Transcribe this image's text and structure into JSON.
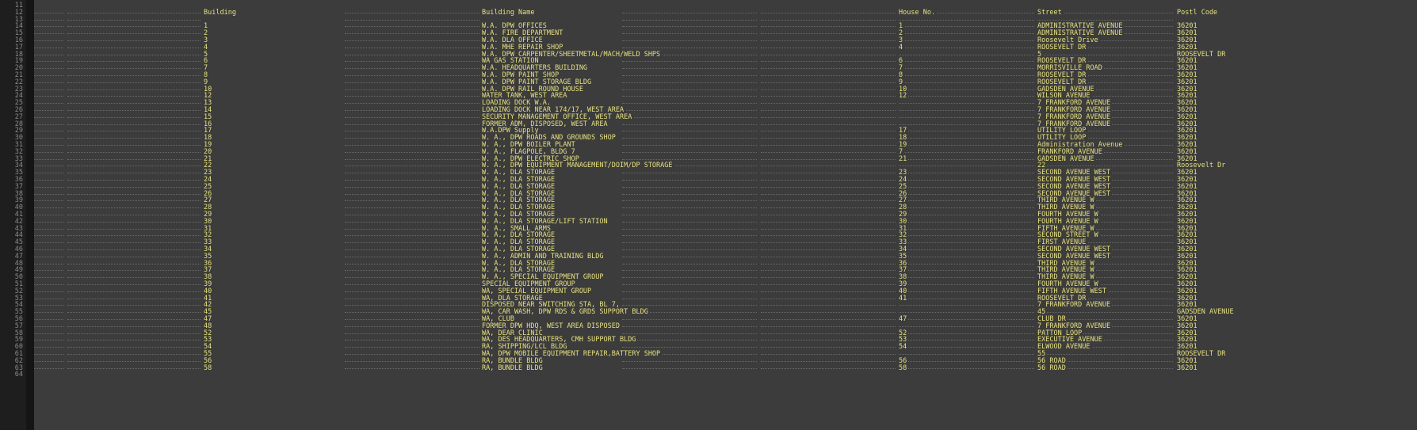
{
  "editor": {
    "first_line_number": 11,
    "last_line_number": 64
  },
  "header": {
    "building": "Building",
    "building_name": "Building Name",
    "house_no": "House No.",
    "street": "Street",
    "postl_code": "Postl Code"
  },
  "rows": [
    {
      "building": "1",
      "name": "W.A. DPW OFFICES",
      "house": "1",
      "street": "ADMINISTRATIVE AVENUE",
      "postal": "36201"
    },
    {
      "building": "2",
      "name": "W.A. FIRE DEPARTMENT",
      "house": "2",
      "street": "ADMINISTRATIVE AVENUE",
      "postal": "36201"
    },
    {
      "building": "3",
      "name": "W.A. DLA OFFICE",
      "house": "3",
      "street": "Roosevelt Drive",
      "postal": "36201"
    },
    {
      "building": "4",
      "name": "W.A. MHE REPAIR SHOP",
      "house": "4",
      "street": "ROOSEVELT DR",
      "postal": "36201"
    },
    {
      "building": "5",
      "name": "W.A. DPW CARPENTER/SHEETMETAL/MACH/WELD SHPS",
      "house": "",
      "street": "5",
      "postal": "ROOSEVELT DR"
    },
    {
      "building": "6",
      "name": "WA GAS STATION",
      "house": "6",
      "street": "ROOSEVELT DR",
      "postal": "36201"
    },
    {
      "building": "7",
      "name": "W.A. HEADQUARTERS BUILDING",
      "house": "7",
      "street": "MORRISVILLE ROAD",
      "postal": "36201"
    },
    {
      "building": "8",
      "name": "W.A. DPW PAINT SHOP",
      "house": "8",
      "street": "ROOSEVELT DR",
      "postal": "36201"
    },
    {
      "building": "9",
      "name": "W.A. DPW PAINT STORAGE BLDG",
      "house": "9",
      "street": "ROOSEVELT DR",
      "postal": "36201"
    },
    {
      "building": "10",
      "name": "W.A. DPW RAIL ROUND HOUSE",
      "house": "10",
      "street": "GADSDEN AVENUE",
      "postal": "36201"
    },
    {
      "building": "12",
      "name": "WATER TANK, WEST AREA",
      "house": "12",
      "street": "WILSON AVENUE",
      "postal": "36201"
    },
    {
      "building": "13",
      "name": "LOADING DOCK W.A.",
      "house": "",
      "street": "7 FRANKFORD AVENUE",
      "postal": "36201"
    },
    {
      "building": "14",
      "name": "LOADING DOCK NEAR 174/17, WEST AREA",
      "house": "",
      "street": "7 FRANKFORD AVENUE",
      "postal": "36201"
    },
    {
      "building": "15",
      "name": "SECURITY MANAGEMENT OFFICE, WEST AREA",
      "house": "",
      "street": "7 FRANKFORD AVENUE",
      "postal": "36201"
    },
    {
      "building": "16",
      "name": "FORMER ADM, DISPOSED, WEST AREA",
      "house": "",
      "street": "7 FRANKFORD AVENUE",
      "postal": "36201"
    },
    {
      "building": "17",
      "name": "W.A.DPW Supply",
      "house": "17",
      "street": "UTILITY LOOP",
      "postal": "36201"
    },
    {
      "building": "18",
      "name": "W. A., DPW ROADS AND GROUNDS SHOP",
      "house": "18",
      "street": "UTILITY LOOP",
      "postal": "36201"
    },
    {
      "building": "19",
      "name": "W. A., DPW BOILER PLANT",
      "house": "19",
      "street": "Administration Avenue",
      "postal": "36201"
    },
    {
      "building": "20",
      "name": "W. A., FLAGPOLE, BLDG 7",
      "house": "7",
      "street": "FRANKFORD AVENUE",
      "postal": "36201"
    },
    {
      "building": "21",
      "name": "W. A., DPW ELECTRIC SHOP",
      "house": "21",
      "street": "GADSDEN AVENUE",
      "postal": "36201"
    },
    {
      "building": "22",
      "name": "W. A., DPW EQUIPMENT MANAGEMENT/DOIM/DP STORAGE",
      "house": "",
      "street": "22",
      "postal": "Roosevelt Dr"
    },
    {
      "building": "23",
      "name": "W. A., DLA STORAGE",
      "house": "23",
      "street": "SECOND AVENUE WEST",
      "postal": "36201"
    },
    {
      "building": "24",
      "name": "W. A., DLA STORAGE",
      "house": "24",
      "street": "SECOND AVENUE WEST",
      "postal": "36201"
    },
    {
      "building": "25",
      "name": "W. A., DLA STORAGE",
      "house": "25",
      "street": "SECOND AVENUE WEST",
      "postal": "36201"
    },
    {
      "building": "26",
      "name": "W. A., DLA STORAGE",
      "house": "26",
      "street": "SECOND AVENUE WEST",
      "postal": "36201"
    },
    {
      "building": "27",
      "name": "W. A., DLA STORAGE",
      "house": "27",
      "street": "THIRD AVENUE W",
      "postal": "36201"
    },
    {
      "building": "28",
      "name": "W. A., DLA STORAGE",
      "house": "28",
      "street": "THIRD AVENUE W",
      "postal": "36201"
    },
    {
      "building": "29",
      "name": "W. A., DLA STORAGE",
      "house": "29",
      "street": "FOURTH AVENUE W",
      "postal": "36201"
    },
    {
      "building": "30",
      "name": "W. A., DLA STORAGE/LIFT STATION",
      "house": "30",
      "street": "FOURTH AVENUE W",
      "postal": "36201"
    },
    {
      "building": "31",
      "name": "W. A., SMALL ARMS",
      "house": "31",
      "street": "FIFTH AVENUE W",
      "postal": "36201"
    },
    {
      "building": "32",
      "name": "W. A., DLA STORAGE",
      "house": "32",
      "street": "SECOND STREET W",
      "postal": "36201"
    },
    {
      "building": "33",
      "name": "W. A., DLA STORAGE",
      "house": "33",
      "street": "FIRST AVENUE",
      "postal": "36201"
    },
    {
      "building": "34",
      "name": "W. A., DLA STORAGE",
      "house": "34",
      "street": "SECOND AVENUE WEST",
      "postal": "36201"
    },
    {
      "building": "35",
      "name": "W. A., ADMIN AND TRAINING BLDG",
      "house": "35",
      "street": "SECOND AVENUE WEST",
      "postal": "36201"
    },
    {
      "building": "36",
      "name": "W. A., DLA STORAGE",
      "house": "36",
      "street": "THIRD AVENUE W",
      "postal": "36201"
    },
    {
      "building": "37",
      "name": "W. A., DLA STORAGE",
      "house": "37",
      "street": "THIRD AVENUE W",
      "postal": "36201"
    },
    {
      "building": "38",
      "name": "W. A., SPECIAL EQUIPMENT GROUP",
      "house": "38",
      "street": "THIRD AVENUE W",
      "postal": "36201"
    },
    {
      "building": "39",
      "name": "SPECIAL EQUIPMENT GROUP",
      "house": "39",
      "street": "FOURTH AVENUE W",
      "postal": "36201"
    },
    {
      "building": "40",
      "name": "WA, SPECIAL EQUIPMENT GROUP",
      "house": "40",
      "street": "FIFTH AVENUE WEST",
      "postal": "36201"
    },
    {
      "building": "41",
      "name": "WA, DLA STORAGE",
      "house": "41",
      "street": "ROOSEVELT DR",
      "postal": "36201"
    },
    {
      "building": "42",
      "name": "DISPOSED NEAR SWITCHING STA, BL 7,",
      "house": "",
      "street": "7 FRANKFORD AVENUE",
      "postal": "36201"
    },
    {
      "building": "45",
      "name": "WA, CAR WASH, DPW RDS & GRDS SUPPORT BLDG",
      "house": "",
      "street": "45",
      "postal": "GADSDEN AVENUE"
    },
    {
      "building": "47",
      "name": "WA, CLUB",
      "house": "47",
      "street": "CLUB DR",
      "postal": "36201"
    },
    {
      "building": "48",
      "name": "FORMER DPW HDQ, WEST AREA DISPOSED",
      "house": "",
      "street": "7 FRANKFORD AVENUE",
      "postal": "36201"
    },
    {
      "building": "52",
      "name": "WA, DEAR CLINIC",
      "house": "52",
      "street": "PATTON LOOP",
      "postal": "36201"
    },
    {
      "building": "53",
      "name": "WA, DES HEADQUARTERS, CMH SUPPORT BLDG",
      "house": "53",
      "street": "EXECUTIVE AVENUE",
      "postal": "36201"
    },
    {
      "building": "54",
      "name": "RA, SHIPPING/LCL BLDG",
      "house": "54",
      "street": "ELWOOD AVENUE",
      "postal": "36201"
    },
    {
      "building": "55",
      "name": "WA, DPW MOBILE EQUIPMENT REPAIR,BATTERY SHOP",
      "house": "",
      "street": "55",
      "postal": "ROOSEVELT DR"
    },
    {
      "building": "56",
      "name": "RA, BUNDLE BLDG",
      "house": "56",
      "street": "56 ROAD",
      "postal": "36201"
    },
    {
      "building": "58",
      "name": "RA, BUNDLE BLDG",
      "house": "58",
      "street": "56 ROAD",
      "postal": "36201"
    }
  ]
}
